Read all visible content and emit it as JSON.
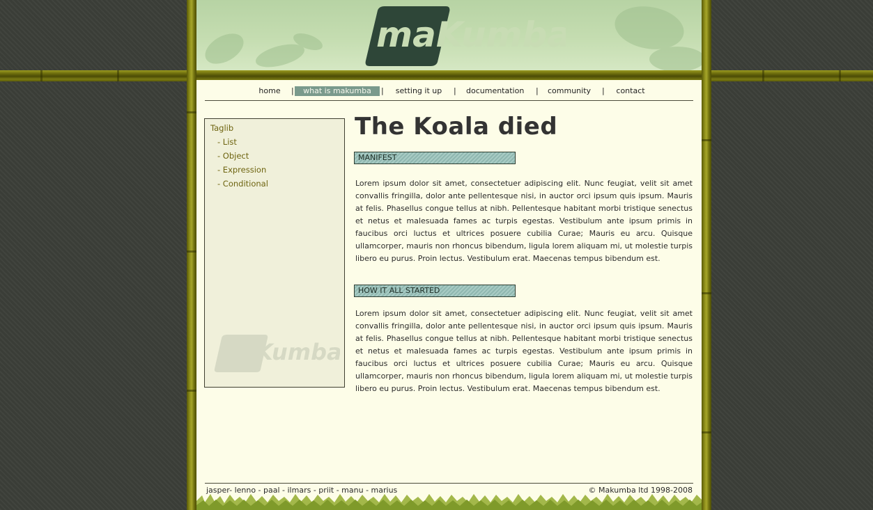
{
  "logo": {
    "text": "maKumba"
  },
  "nav": {
    "items": [
      {
        "label": "home"
      },
      {
        "label": "what is makumba"
      },
      {
        "label": "setting it up"
      },
      {
        "label": "documentation"
      },
      {
        "label": "community"
      },
      {
        "label": "contact"
      }
    ],
    "active_index": 1,
    "separator": "|"
  },
  "sidebar": {
    "title": "Taglib",
    "items": [
      {
        "label": "- List"
      },
      {
        "label": "- Object"
      },
      {
        "label": "- Expression"
      },
      {
        "label": "- Conditional"
      }
    ]
  },
  "main": {
    "title": "The Koala died",
    "sections": [
      {
        "header": "MANIFEST",
        "text": "Lorem ipsum dolor sit amet, consectetuer adipiscing elit. Nunc feugiat, velit sit amet convallis fringilla, dolor ante pellentesque nisi, in auctor orci ipsum quis ipsum. Mauris at felis. Phasellus congue tellus at nibh. Pellentesque habitant morbi tristique senectus et netus et malesuada fames ac turpis egestas. Vestibulum ante ipsum primis in faucibus orci luctus et ultrices posuere cubilia Curae; Mauris eu arcu. Quisque ullamcorper, mauris non rhoncus bibendum, ligula lorem aliquam mi, ut molestie turpis libero eu purus. Proin lectus. Vestibulum erat. Maecenas tempus bibendum est."
      },
      {
        "header": "HOW IT ALL STARTED",
        "text": "Lorem ipsum dolor sit amet, consectetuer adipiscing elit. Nunc feugiat, velit sit amet convallis fringilla, dolor ante pellentesque nisi, in auctor orci ipsum quis ipsum. Mauris at felis. Phasellus congue tellus at nibh. Pellentesque habitant morbi tristique senectus et netus et malesuada fames ac turpis egestas. Vestibulum ante ipsum primis in faucibus orci luctus et ultrices posuere cubilia Curae; Mauris eu arcu. Quisque ullamcorper, mauris non rhoncus bibendum, ligula lorem aliquam mi, ut molestie turpis libero eu purus. Proin lectus. Vestibulum erat. Maecenas tempus bibendum est."
      }
    ]
  },
  "footer": {
    "authors": "jasper- lenno - paal - ilmars - priit - manu - marius",
    "copyright": "© Makumba ltd 1998-2008"
  },
  "colors": {
    "background": "#3a3d37",
    "bamboo": "#8d8d1a",
    "page": "#fdfde8",
    "header_green": "#c5ddb1",
    "nav_active": "#7a9a8c",
    "section_header": "#a8cbc4",
    "sidebar_link": "#6e6410",
    "logo_dark": "#2e4638"
  }
}
